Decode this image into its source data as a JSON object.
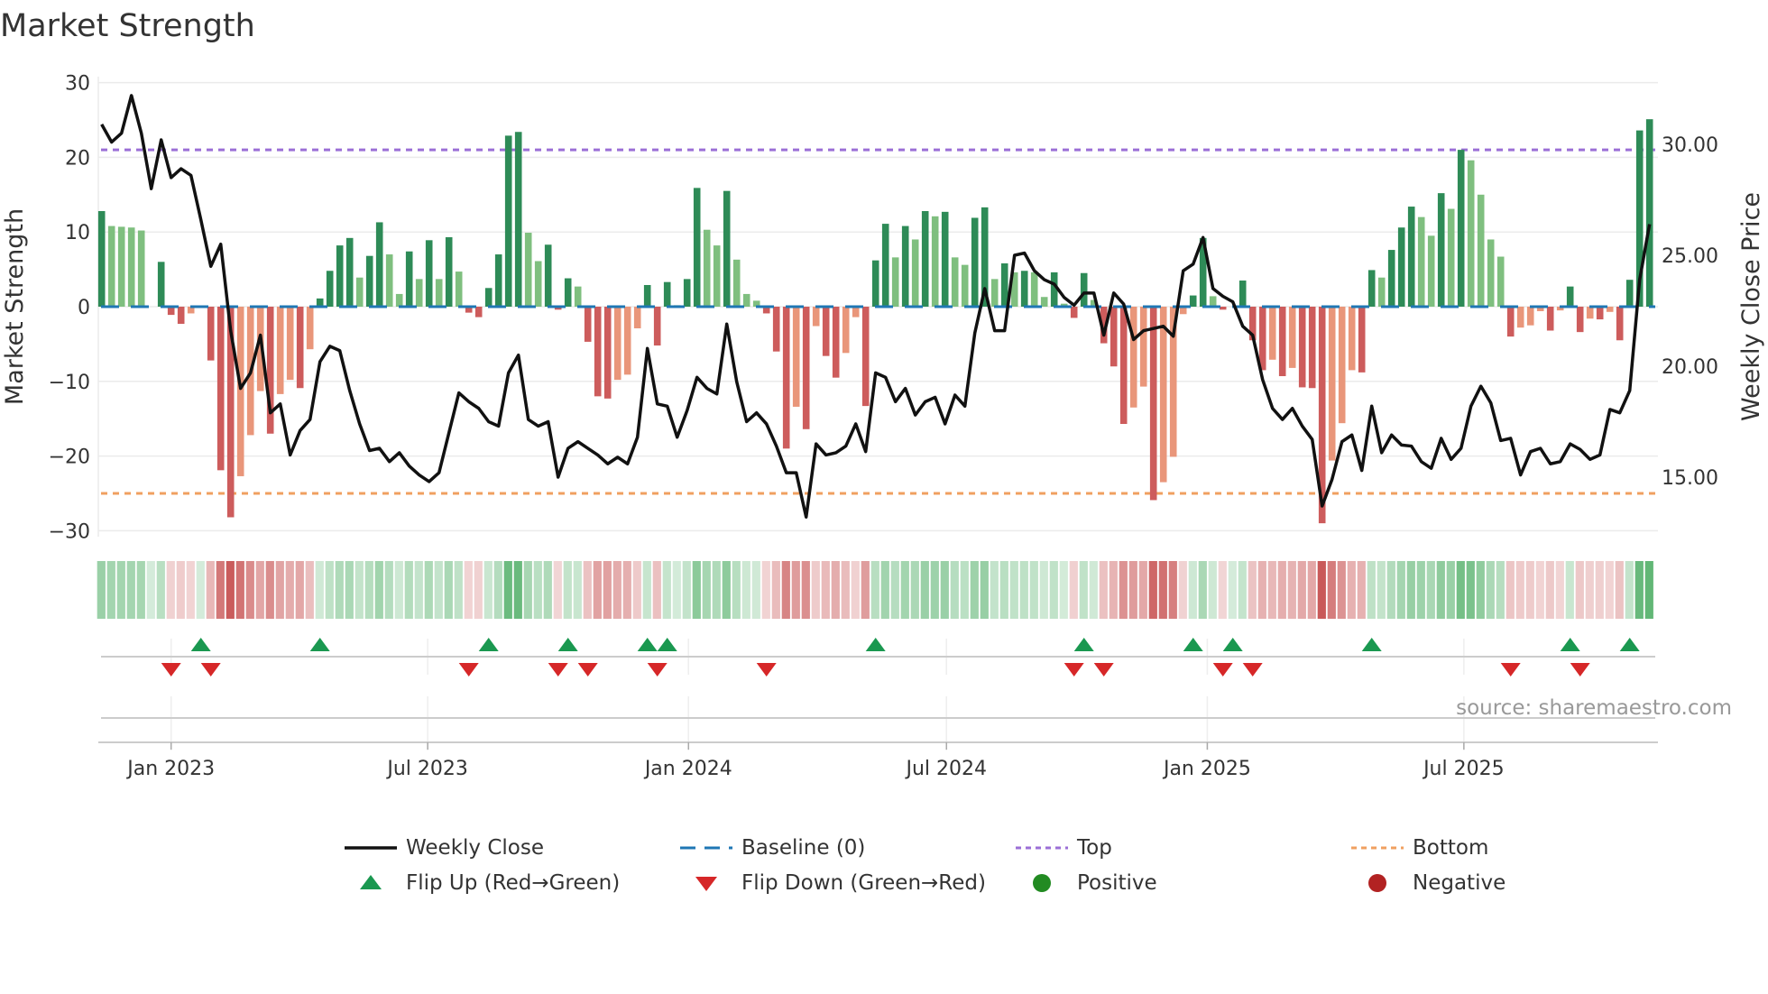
{
  "chart_data": {
    "type": "bar",
    "title": "Market Strength",
    "ylabel": "Market Strength",
    "y2label": "Weekly Close Price",
    "ylim": [
      -30,
      30
    ],
    "y2lim": [
      12.2,
      32.5
    ],
    "yticks": [
      30,
      20,
      10,
      0,
      -10,
      -20,
      -30
    ],
    "yticks_labels": [
      "30",
      "20",
      "10",
      "0",
      "−10",
      "−20",
      "−30"
    ],
    "y2ticks": [
      30,
      25,
      20,
      15
    ],
    "y2ticks_labels": [
      "30.00",
      "25.00",
      "20.00",
      "15.00"
    ],
    "grid": true,
    "frequency": "weekly",
    "start_week": "2022-11-13",
    "xticks": [
      {
        "label": "Jan 2023",
        "date": "2023-01-01"
      },
      {
        "label": "Jul 2023",
        "date": "2023-07-01"
      },
      {
        "label": "Jan 2024",
        "date": "2024-01-01"
      },
      {
        "label": "Jul 2024",
        "date": "2024-07-01"
      },
      {
        "label": "Jan 2025",
        "date": "2025-01-01"
      },
      {
        "label": "Jul 2025",
        "date": "2025-07-01"
      }
    ],
    "top_level": 21,
    "bottom_level": -25,
    "baseline": 0,
    "series": [
      {
        "name": "Market Strength",
        "values": [
          12.8,
          10.8,
          10.7,
          10.6,
          10.2,
          0,
          6.0,
          -1.1,
          -2.3,
          -0.9,
          0,
          -7.2,
          -21.9,
          -28.2,
          -22.7,
          -17.2,
          -11.3,
          -17.0,
          -11.7,
          -9.8,
          -10.9,
          -5.7,
          1.1,
          4.8,
          8.2,
          9.2,
          3.9,
          6.8,
          11.3,
          7.0,
          1.7,
          7.4,
          3.7,
          8.9,
          3.7,
          9.3,
          4.7,
          -0.8,
          -1.4,
          2.5,
          7.0,
          22.9,
          23.4,
          9.9,
          6.1,
          8.3,
          -0.4,
          3.8,
          2.7,
          -4.7,
          -12.0,
          -12.3,
          -9.8,
          -9.1,
          -2.9,
          2.9,
          -5.2,
          3.3,
          0.2,
          3.7,
          15.9,
          10.3,
          8.2,
          15.5,
          6.3,
          1.7,
          0.8,
          -0.9,
          -6.0,
          -19.0,
          -13.4,
          -16.4,
          -2.6,
          -6.6,
          -9.5,
          -6.2,
          -1.4,
          -13.3,
          6.2,
          11.1,
          6.6,
          10.8,
          9.0,
          12.8,
          12.1,
          12.7,
          6.6,
          5.6,
          11.9,
          13.3,
          3.7,
          5.8,
          4.6,
          4.8,
          4.6,
          1.3,
          4.6,
          0.4,
          -1.5,
          4.5,
          0.9,
          -4.9,
          -8.0,
          -15.7,
          -13.5,
          -10.7,
          -25.9,
          -23.5,
          -20.1,
          -1.0,
          1.5,
          9.2,
          1.4,
          -0.4,
          0,
          3.5,
          -4.5,
          -8.5,
          -7.1,
          -9.3,
          -8.2,
          -10.8,
          -10.9,
          -29.0,
          -20.6,
          -15.6,
          -8.5,
          -8.8,
          4.9,
          3.9,
          7.6,
          10.6,
          13.4,
          12.0,
          9.5,
          15.2,
          13.1,
          21.0,
          19.6,
          15.0,
          9.0,
          6.7,
          -4.0,
          -2.8,
          -2.5,
          -0.6,
          -3.2,
          -0.5,
          2.7,
          -3.4,
          -1.6,
          -1.7,
          -0.7,
          -4.5,
          3.6,
          23.6,
          25.1
        ]
      },
      {
        "name": "Weekly Close",
        "axis": "right",
        "values": [
          30.9,
          30.1,
          30.5,
          32.2,
          30.5,
          28.0,
          30.2,
          28.5,
          28.9,
          28.6,
          26.6,
          24.5,
          25.5,
          21.6,
          19.0,
          19.7,
          21.4,
          17.9,
          18.3,
          16.0,
          17.1,
          17.6,
          20.2,
          20.9,
          20.7,
          18.9,
          17.4,
          16.2,
          16.3,
          15.7,
          16.1,
          15.5,
          15.1,
          14.8,
          15.2,
          17.0,
          18.8,
          18.4,
          18.1,
          17.5,
          17.3,
          19.7,
          20.5,
          17.6,
          17.3,
          17.5,
          15.0,
          16.3,
          16.6,
          16.3,
          16.0,
          15.6,
          15.9,
          15.6,
          16.8,
          20.8,
          18.3,
          18.2,
          16.8,
          18.0,
          19.5,
          19.0,
          18.75,
          21.9,
          19.3,
          17.5,
          17.9,
          17.4,
          16.4,
          15.2,
          15.2,
          13.2,
          16.5,
          16.0,
          16.1,
          16.4,
          17.4,
          16.15,
          19.7,
          19.5,
          18.4,
          19.0,
          17.8,
          18.4,
          18.6,
          17.4,
          18.7,
          18.2,
          21.5,
          23.5,
          21.6,
          21.6,
          25.0,
          25.1,
          24.3,
          23.9,
          23.7,
          23.1,
          22.75,
          23.3,
          23.3,
          21.4,
          23.3,
          22.8,
          21.2,
          21.6,
          21.7,
          21.8,
          21.35,
          24.3,
          24.6,
          25.8,
          23.5,
          23.15,
          22.9,
          21.8,
          21.4,
          19.4,
          18.1,
          17.6,
          18.1,
          17.3,
          16.7,
          13.7,
          14.9,
          16.6,
          16.9,
          15.3,
          18.2,
          16.1,
          16.9,
          16.45,
          16.4,
          15.7,
          15.4,
          16.75,
          15.8,
          16.3,
          18.2,
          19.1,
          18.35,
          16.65,
          16.75,
          15.1,
          16.15,
          16.3,
          15.6,
          15.7,
          16.5,
          16.25,
          15.8,
          16.0,
          18.05,
          17.9,
          18.9,
          23.9,
          26.4
        ]
      }
    ],
    "flip_up_week_index": [
      10,
      22,
      39,
      47,
      55,
      57,
      78,
      99,
      110,
      114,
      128,
      148,
      154
    ],
    "flip_down_week_index": [
      7,
      11,
      37,
      46,
      49,
      56,
      67,
      98,
      101,
      113,
      116,
      142,
      149
    ],
    "legend": {
      "placement": "bottom",
      "entries": [
        {
          "label": "Weekly Close",
          "kind": "line"
        },
        {
          "label": "Baseline (0)",
          "kind": "dash"
        },
        {
          "label": "Top",
          "kind": "dot"
        },
        {
          "label": "Bottom",
          "kind": "dot"
        },
        {
          "label": "Flip Up (Red→Green)",
          "kind": "triangle-up"
        },
        {
          "label": "Flip Down (Green→Red)",
          "kind": "triangle-down"
        },
        {
          "label": "Positive",
          "kind": "circle"
        },
        {
          "label": "Negative",
          "kind": "circle"
        }
      ]
    },
    "source": "source: sharemaestro.com"
  },
  "colors": {
    "pos_rising": "#2e8b57",
    "pos_falling": "#7fbf7f",
    "neg_falling": "#cd5c5c",
    "neg_rising": "#e9967a",
    "price_line": "#111111",
    "baseline": "#1f77b4",
    "top": "#9b6fd6",
    "bottom": "#f0a060",
    "flip_up": "#1a9850",
    "flip_down": "#d62728",
    "positive": "#228b22",
    "negative": "#b22222",
    "grid": "#ebebeb"
  }
}
